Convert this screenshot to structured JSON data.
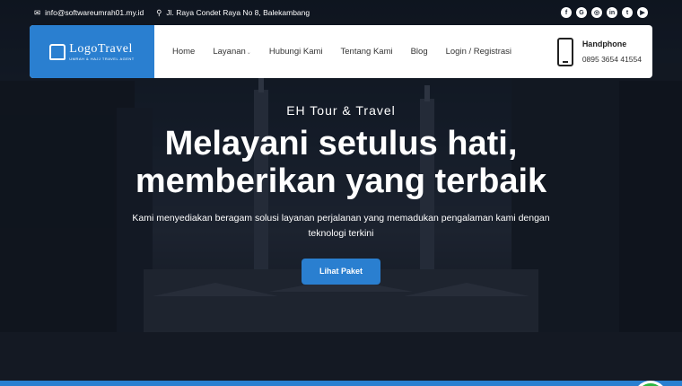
{
  "topbar": {
    "email": "info@softwareumrah01.my.id",
    "address": "Jl. Raya Condet Raya No 8, Balekambang",
    "socials": [
      "facebook-icon",
      "google-plus-icon",
      "instagram-icon",
      "linkedin-icon",
      "twitter-icon",
      "youtube-icon"
    ]
  },
  "logo": {
    "main": "LogoTravel",
    "sub": "UMRAH & HAJJ TRAVEL AGENT"
  },
  "nav": {
    "home": "Home",
    "layanan": "Layanan",
    "hubungi": "Hubungi Kami",
    "tentang": "Tentang Kami",
    "blog": "Blog",
    "login": "Login / Registrasi"
  },
  "contact": {
    "label": "Handphone",
    "phone": "0895 3654 41554"
  },
  "hero": {
    "subtitle": "EH Tour & Travel",
    "headline": "Melayani setulus hati, memberikan yang terbaik",
    "description": "Kami menyediakan beragam solusi layanan perjalanan yang memadukan pengalaman kami dengan teknologi terkini",
    "button": "Lihat Paket"
  },
  "colors": {
    "accent": "#2a7fd0",
    "whatsapp": "#2bb741"
  }
}
